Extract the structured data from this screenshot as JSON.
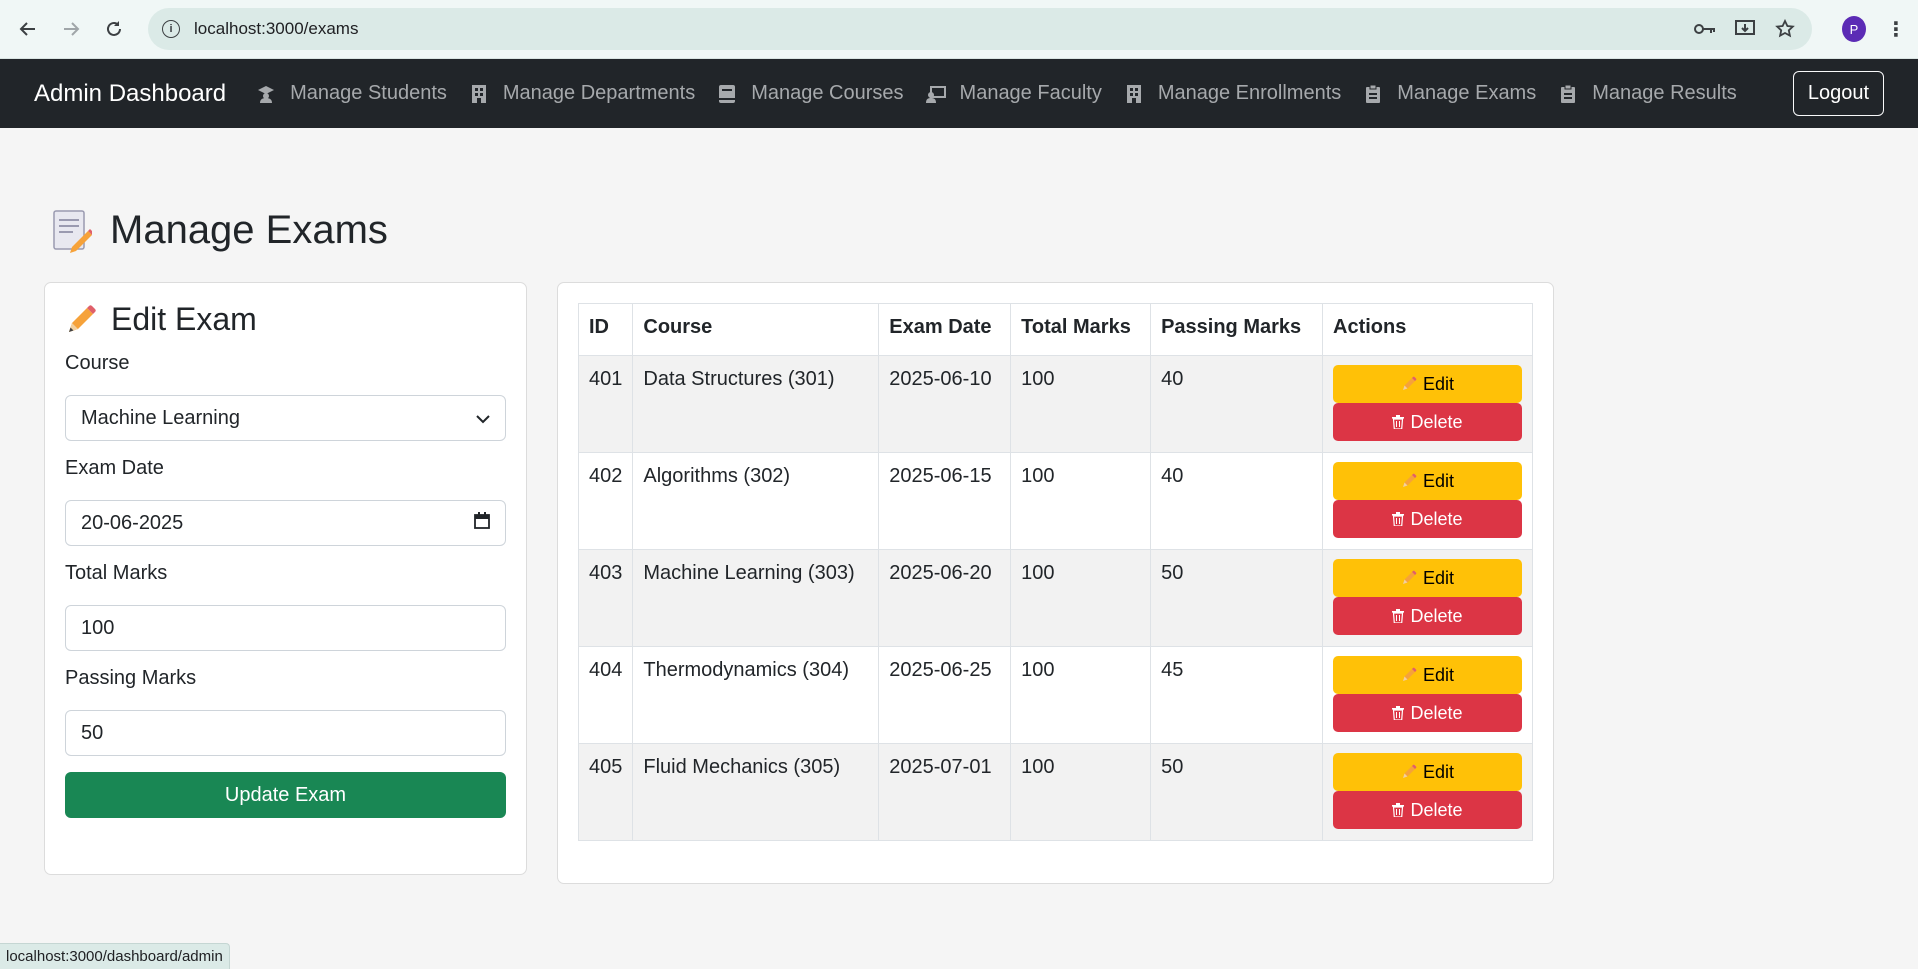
{
  "browser": {
    "url": "localhost:3000/exams",
    "profile_initial": "P"
  },
  "navbar": {
    "brand": "Admin Dashboard",
    "links": [
      {
        "label": "Manage Students",
        "icon": "student-icon"
      },
      {
        "label": "Manage Departments",
        "icon": "building-icon"
      },
      {
        "label": "Manage Courses",
        "icon": "book-icon"
      },
      {
        "label": "Manage Faculty",
        "icon": "teacher-icon"
      },
      {
        "label": "Manage Enrollments",
        "icon": "building-icon"
      },
      {
        "label": "Manage Exams",
        "icon": "clipboard-icon"
      },
      {
        "label": "Manage Results",
        "icon": "clipboard-icon"
      }
    ],
    "logout_label": "Logout"
  },
  "page": {
    "title": "Manage Exams"
  },
  "form": {
    "title": "Edit Exam",
    "course_label": "Course",
    "course_value": "Machine Learning",
    "exam_date_label": "Exam Date",
    "exam_date_value": "20-06-2025",
    "total_marks_label": "Total Marks",
    "total_marks_value": "100",
    "passing_marks_label": "Passing Marks",
    "passing_marks_value": "50",
    "submit_label": "Update Exam"
  },
  "table": {
    "headers": [
      "ID",
      "Course",
      "Exam Date",
      "Total Marks",
      "Passing Marks",
      "Actions"
    ],
    "edit_label": "Edit",
    "delete_label": "Delete",
    "rows": [
      {
        "id": "401",
        "course": "Data Structures (301)",
        "date": "2025-06-10",
        "total": "100",
        "passing": "40"
      },
      {
        "id": "402",
        "course": "Algorithms (302)",
        "date": "2025-06-15",
        "total": "100",
        "passing": "40"
      },
      {
        "id": "403",
        "course": "Machine Learning (303)",
        "date": "2025-06-20",
        "total": "100",
        "passing": "50"
      },
      {
        "id": "404",
        "course": "Thermodynamics (304)",
        "date": "2025-06-25",
        "total": "100",
        "passing": "45"
      },
      {
        "id": "405",
        "course": "Fluid Mechanics (305)",
        "date": "2025-07-01",
        "total": "100",
        "passing": "50"
      }
    ]
  },
  "status_bar": {
    "text": "localhost:3000/dashboard/admin"
  },
  "colors": {
    "navbar_bg": "#212529",
    "edit_button": "#ffc107",
    "delete_button": "#dc3545",
    "update_button": "#198754"
  }
}
